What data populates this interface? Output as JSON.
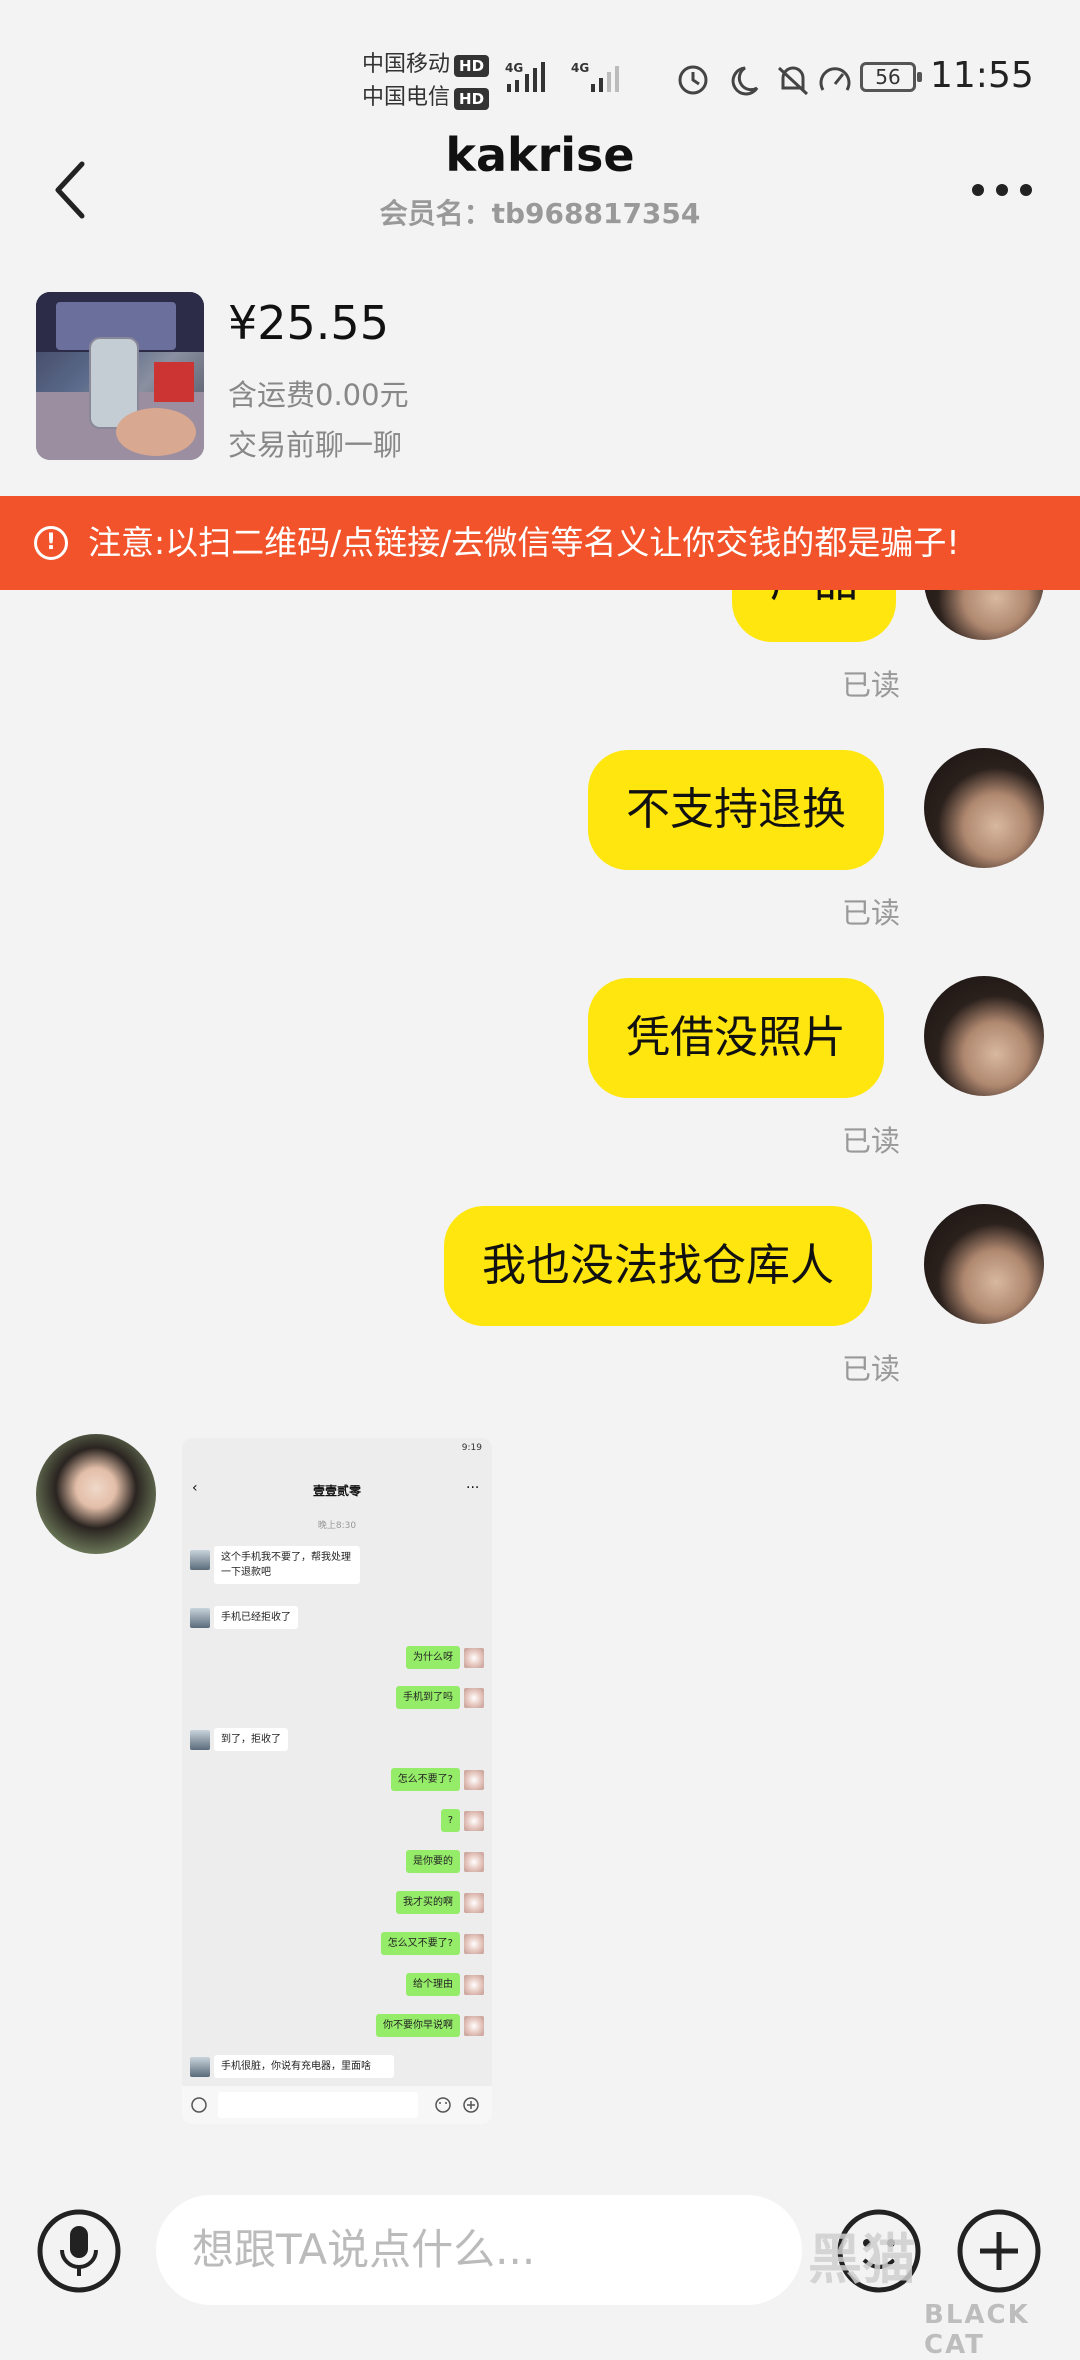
{
  "status_bar": {
    "carrier1": "中国移动",
    "carrier2": "中国电信",
    "hd": "HD",
    "network": "4G",
    "battery": "56",
    "time": "11:55"
  },
  "header": {
    "title": "kakrise",
    "subtitle": "会员名：tb968817354"
  },
  "product": {
    "price": "¥25.55",
    "shipping": "含运费0.00元",
    "chat_prompt": "交易前聊一聊"
  },
  "warning": {
    "text": "注意:以扫二维码/点链接/去微信等名义让你交钱的都是骗子!"
  },
  "messages": [
    {
      "text": "产品",
      "status": "已读"
    },
    {
      "text": "不支持退换",
      "status": "已读"
    },
    {
      "text": "凭借没照片",
      "status": "已读"
    },
    {
      "text": "我也没法找仓库人",
      "status": "已读"
    }
  ],
  "embedded_screenshot": {
    "time": "9:19",
    "title": "壹壹贰零",
    "timestamp": "晚上8:30",
    "messages": [
      {
        "side": "left",
        "text": "这个手机我不要了，帮我处理一下退款吧"
      },
      {
        "side": "left",
        "text": "手机已经拒收了"
      },
      {
        "side": "right",
        "text": "为什么呀"
      },
      {
        "side": "right",
        "text": "手机到了吗"
      },
      {
        "side": "left",
        "text": "到了，拒收了"
      },
      {
        "side": "right",
        "text": "怎么不要了?"
      },
      {
        "side": "right",
        "text": "?"
      },
      {
        "side": "right",
        "text": "是你要的"
      },
      {
        "side": "right",
        "text": "我才买的啊"
      },
      {
        "side": "right",
        "text": "怎么又不要了?"
      },
      {
        "side": "right",
        "text": "给个理由"
      },
      {
        "side": "right",
        "text": "你不要你早说啊"
      },
      {
        "side": "left",
        "text": "手机很脏，你说有充电器，里面啥"
      }
    ]
  },
  "input_bar": {
    "placeholder": "想跟TA说点什么..."
  },
  "watermark": {
    "cn": "黑猫",
    "en": "BLACK CAT"
  },
  "colors": {
    "bubble": "#ffe60f",
    "warning": "#f2532a",
    "background": "#f3f3f3"
  }
}
